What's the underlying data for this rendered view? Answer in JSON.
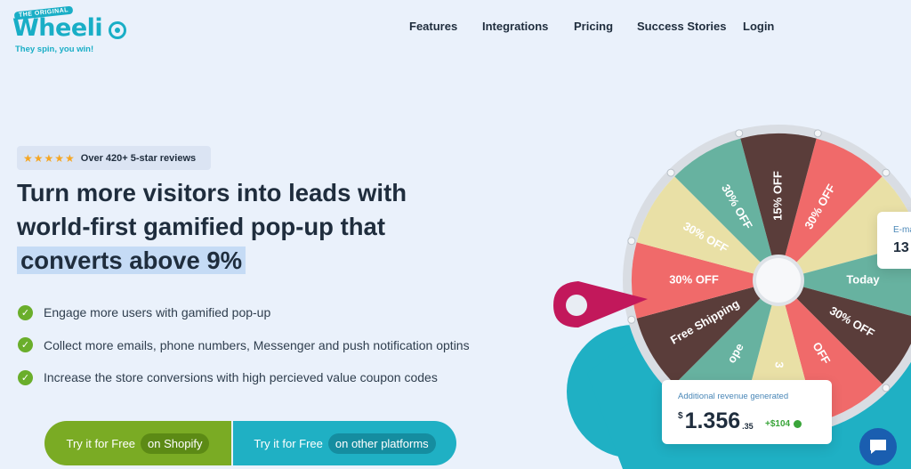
{
  "logo": {
    "badge": "THE ORIGINAL",
    "wordmark": "Wheeli",
    "tagline": "They spin, you win!",
    "brand_color": "#19aec6"
  },
  "nav": {
    "items": [
      {
        "label": "Features"
      },
      {
        "label": "Integrations"
      },
      {
        "label": "Pricing"
      },
      {
        "label": "Success Stories"
      },
      {
        "label": "Login"
      }
    ]
  },
  "reviews": {
    "stars": "★★★★★",
    "text": "Over 420+ 5-star reviews"
  },
  "headline": {
    "line1": "Turn more visitors into leads with",
    "line2": "world-first gamified pop-up that",
    "line3": "converts above 9%"
  },
  "bullets": [
    "Engage more users with gamified pop-up",
    "Collect more emails, phone numbers, Messenger and push notification optins",
    "Increase the store conversions with high percieved value coupon codes"
  ],
  "cta": {
    "shopify": {
      "label": "Try it for Free",
      "pill": "on Shopify"
    },
    "other": {
      "label": "Try it for Free",
      "pill": "on other platforms"
    }
  },
  "wheel": {
    "segments": [
      {
        "label": "30% OFF",
        "color": "#f06a6a"
      },
      {
        "label": "",
        "color": "#e9e0a6"
      },
      {
        "label": "Today",
        "color": "#67b2a0"
      },
      {
        "label": "30% OFF",
        "color": "#5a3d3a"
      },
      {
        "label": "OFF",
        "color": "#f06a6a"
      },
      {
        "label": "3",
        "color": "#e9e0a6"
      },
      {
        "label": "ope",
        "color": "#67b2a0"
      },
      {
        "label": "Free Shipping",
        "color": "#5a3d3a"
      },
      {
        "label": "30% OFF",
        "color": "#f06a6a"
      },
      {
        "label": "30% OFF",
        "color": "#e9e0a6"
      },
      {
        "label": "30% OFF",
        "color": "#67b2a0"
      },
      {
        "label": "15% OFF",
        "color": "#5a3d3a"
      }
    ]
  },
  "revenue_card": {
    "label": "Additional revenue generated",
    "currency": "$",
    "value": "1.356",
    "cents": ".35",
    "delta": "+$104"
  },
  "email_card": {
    "label": "E-ma",
    "value": "13"
  },
  "colors": {
    "background": "#eaf1fb",
    "green": "#7aab24",
    "teal": "#1fb0c4",
    "pointer": "#c2185b"
  }
}
